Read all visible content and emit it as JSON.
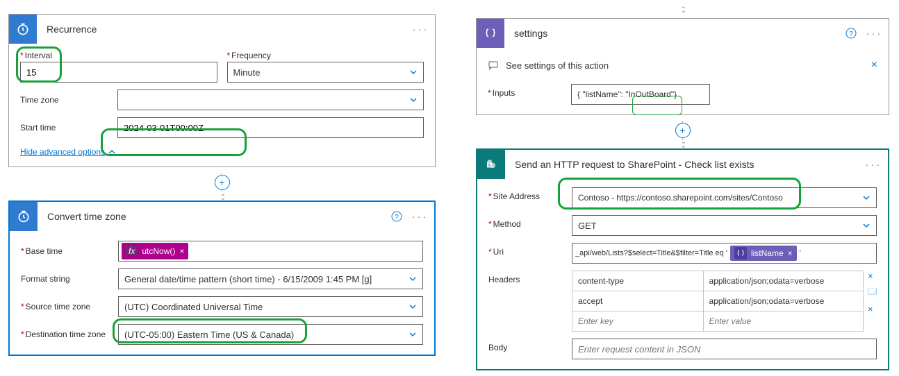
{
  "left": {
    "recurrence": {
      "title": "Recurrence",
      "intervalLabel": "Interval",
      "intervalValue": "15",
      "frequencyLabel": "Frequency",
      "frequencyValue": "Minute",
      "timezoneLabel": "Time zone",
      "timezoneValue": "",
      "starttimeLabel": "Start time",
      "starttimeValue": "2024-03-01T00:00Z",
      "hideAdvanced": "Hide advanced options"
    },
    "convert": {
      "title": "Convert time zone",
      "baseTimeLabel": "Base time",
      "baseTimeExpr": "utcNow()",
      "formatLabel": "Format string",
      "formatValue": "General date/time pattern (short time) - 6/15/2009 1:45 PM [g]",
      "sourceTzLabel": "Source time zone",
      "sourceTzValue": "(UTC) Coordinated Universal Time",
      "destTzLabel": "Destination time zone",
      "destTzValue": "(UTC-05:00) Eastern Time (US & Canada)"
    }
  },
  "right": {
    "settings": {
      "title": "settings",
      "note": "See settings of this action",
      "inputsLabel": "Inputs",
      "inputsValue": "{ \"listName\": \"InOutBoard\"}"
    },
    "http": {
      "title": "Send an HTTP request to SharePoint - Check list exists",
      "siteLabel": "Site Address",
      "siteValue": "Contoso - https://contoso.sharepoint.com/sites/Contoso",
      "methodLabel": "Method",
      "methodValue": "GET",
      "uriLabel": "Uri",
      "uriPrefix": "_api/web/Lists?$select=Title&$filter=Title eq '",
      "uriVar": "listName",
      "headersLabel": "Headers",
      "headers": [
        {
          "k": "content-type",
          "v": "application/json;odata=verbose"
        },
        {
          "k": "accept",
          "v": "application/json;odata=verbose"
        }
      ],
      "keyPlaceholder": "Enter key",
      "valPlaceholder": "Enter value",
      "bodyLabel": "Body",
      "bodyPlaceholder": "Enter request content in JSON"
    }
  }
}
